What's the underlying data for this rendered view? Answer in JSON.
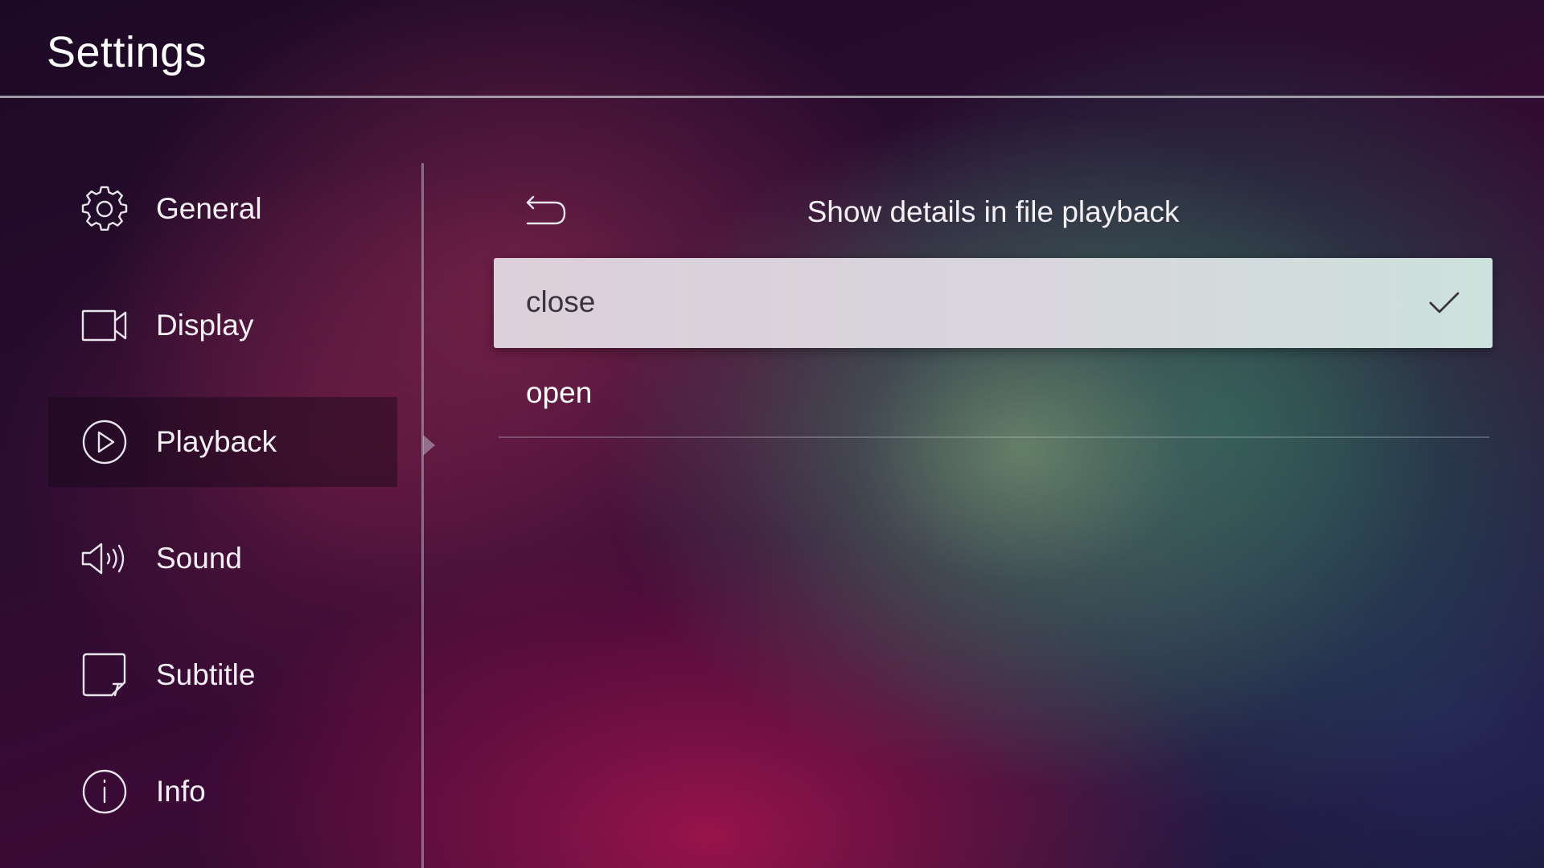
{
  "header": {
    "title": "Settings"
  },
  "sidebar": {
    "items": [
      {
        "label": "General",
        "icon": "gear-icon",
        "active": false
      },
      {
        "label": "Display",
        "icon": "display-icon",
        "active": false
      },
      {
        "label": "Playback",
        "icon": "play-icon",
        "active": true
      },
      {
        "label": "Sound",
        "icon": "speaker-icon",
        "active": false
      },
      {
        "label": "Subtitle",
        "icon": "subtitle-icon",
        "active": false
      },
      {
        "label": "Info",
        "icon": "info-icon",
        "active": false
      }
    ]
  },
  "main": {
    "back_icon": "back-arrow-icon",
    "title": "Show details in file playback",
    "options": [
      {
        "label": "close",
        "selected": true,
        "icon": "check-icon"
      },
      {
        "label": "open",
        "selected": false
      }
    ]
  },
  "colors": {
    "selected_option_bg": "#d8d6dc",
    "selected_option_text": "#3a3340",
    "text": "#ffffff"
  }
}
